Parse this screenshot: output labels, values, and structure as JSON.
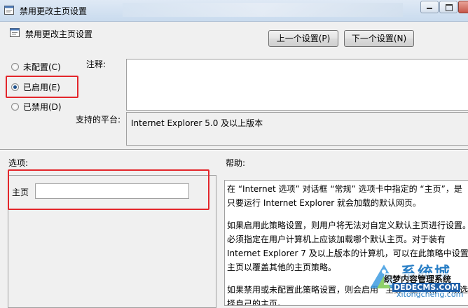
{
  "window": {
    "title": "禁用更改主页设置"
  },
  "policy": {
    "title": "禁用更改主页设置"
  },
  "nav": {
    "prev_label": "上一个设置(P)",
    "next_label": "下一个设置(N)"
  },
  "state": {
    "options": [
      {
        "label": "未配置(C)",
        "checked": false
      },
      {
        "label": "已启用(E)",
        "checked": true
      },
      {
        "label": "已禁用(D)",
        "checked": false
      }
    ]
  },
  "comment": {
    "label": "注释:",
    "value": ""
  },
  "platform": {
    "label": "支持的平台:",
    "value": "Internet Explorer 5.0 及以上版本"
  },
  "options_section": {
    "label": "选项:",
    "home_label": "主页",
    "home_value": ""
  },
  "help_section": {
    "label": "帮助:",
    "paragraphs": [
      "在 “Internet 选项” 对话框 “常规” 选项卡中指定的 “主页”，是\n只要运行 Internet Explorer 就会加载的默认网页。",
      "如果启用此策略设置，则用户将无法对自定义默认主页进行设置。\n必须指定在用户计算机上应该加载哪个默认主页。对于装有\nInternet Explorer 7 及以上版本的计算机，可以在此策略中设置\n主页以覆盖其他的主页策略。",
      "如果禁用或未配置此策略设置，则会启用 “主页” 框，用户可以选\n择自己的主页。"
    ]
  },
  "watermark": {
    "big": "系统城",
    "line1": "织梦内容管理系统",
    "line2": "DEDECMS.COM",
    "line3": "xitongcheng.com"
  },
  "colors": {
    "highlight_red": "#e3262b",
    "window_bg": "#f0f0f0",
    "watermark_blue": "#2a7fc6"
  }
}
